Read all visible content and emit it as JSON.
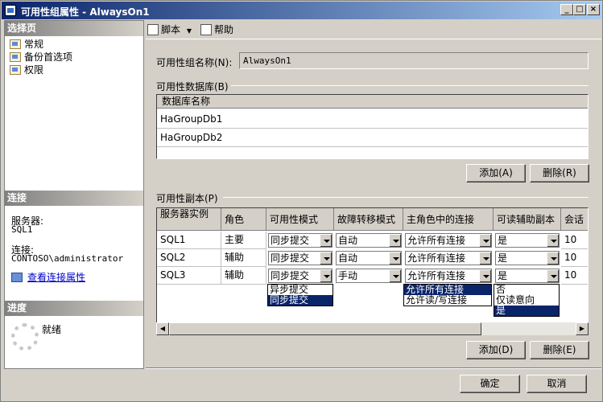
{
  "window": {
    "title": "可用性组属性 - AlwaysOn1",
    "controls": [
      "_",
      "□",
      "×"
    ]
  },
  "left_panel": {
    "select_page_header": "选择页",
    "pages": [
      {
        "label": "常规",
        "icon": "property-page-icon"
      },
      {
        "label": "备份首选项",
        "icon": "property-page-icon"
      },
      {
        "label": "权限",
        "icon": "property-page-icon"
      }
    ],
    "connection_header": "连接",
    "server_label": "服务器:",
    "server_value": "SQL1",
    "connection_label": "连接:",
    "connection_value": "CONTOSO\\administrator",
    "view_connection_link": "查看连接属性",
    "progress_header": "进度",
    "progress_status": "就绪"
  },
  "toolbar": {
    "script_label": "脚本",
    "help_label": "帮助"
  },
  "general": {
    "ag_name_label": "可用性组名称(N):",
    "ag_name_value": "AlwaysOn1",
    "databases_label": "可用性数据库(B)",
    "db_column_header": "数据库名称",
    "databases": [
      "HaGroupDb1",
      "HaGroupDb2"
    ],
    "add_db_button": "添加(A)",
    "remove_db_button": "删除(R)",
    "replicas_label": "可用性副本(P)",
    "replica_columns": [
      "服务器实例",
      "角色",
      "可用性模式",
      "故障转移模式",
      "主角色中的连接",
      "可读辅助副本",
      "会话超"
    ],
    "replicas": [
      {
        "server": "SQL1",
        "role": "主要",
        "availability_mode": "同步提交",
        "failover_mode": "自动",
        "primary_connections": "允许所有连接",
        "readable_secondary": "是",
        "session_timeout": "10"
      },
      {
        "server": "SQL2",
        "role": "辅助",
        "availability_mode": "同步提交",
        "failover_mode": "自动",
        "primary_connections": "允许所有连接",
        "readable_secondary": "是",
        "session_timeout": "10"
      },
      {
        "server": "SQL3",
        "role": "辅助",
        "availability_mode": "同步提交",
        "failover_mode": "手动",
        "primary_connections": "允许所有连接",
        "readable_secondary": "是",
        "session_timeout": "10"
      }
    ],
    "dropdown_availability_mode": [
      "异步提交",
      "同步提交"
    ],
    "dropdown_availability_selected": 1,
    "dropdown_primary_connections": [
      "允许所有连接",
      "允许读/写连接"
    ],
    "dropdown_primary_selected": 0,
    "dropdown_readable_secondary": [
      "否",
      "仅读意向",
      "是"
    ],
    "dropdown_readable_selected": 2,
    "add_replica_button": "添加(D)",
    "remove_replica_button": "删除(E)"
  },
  "footer": {
    "ok_button": "确定",
    "cancel_button": "取消"
  }
}
